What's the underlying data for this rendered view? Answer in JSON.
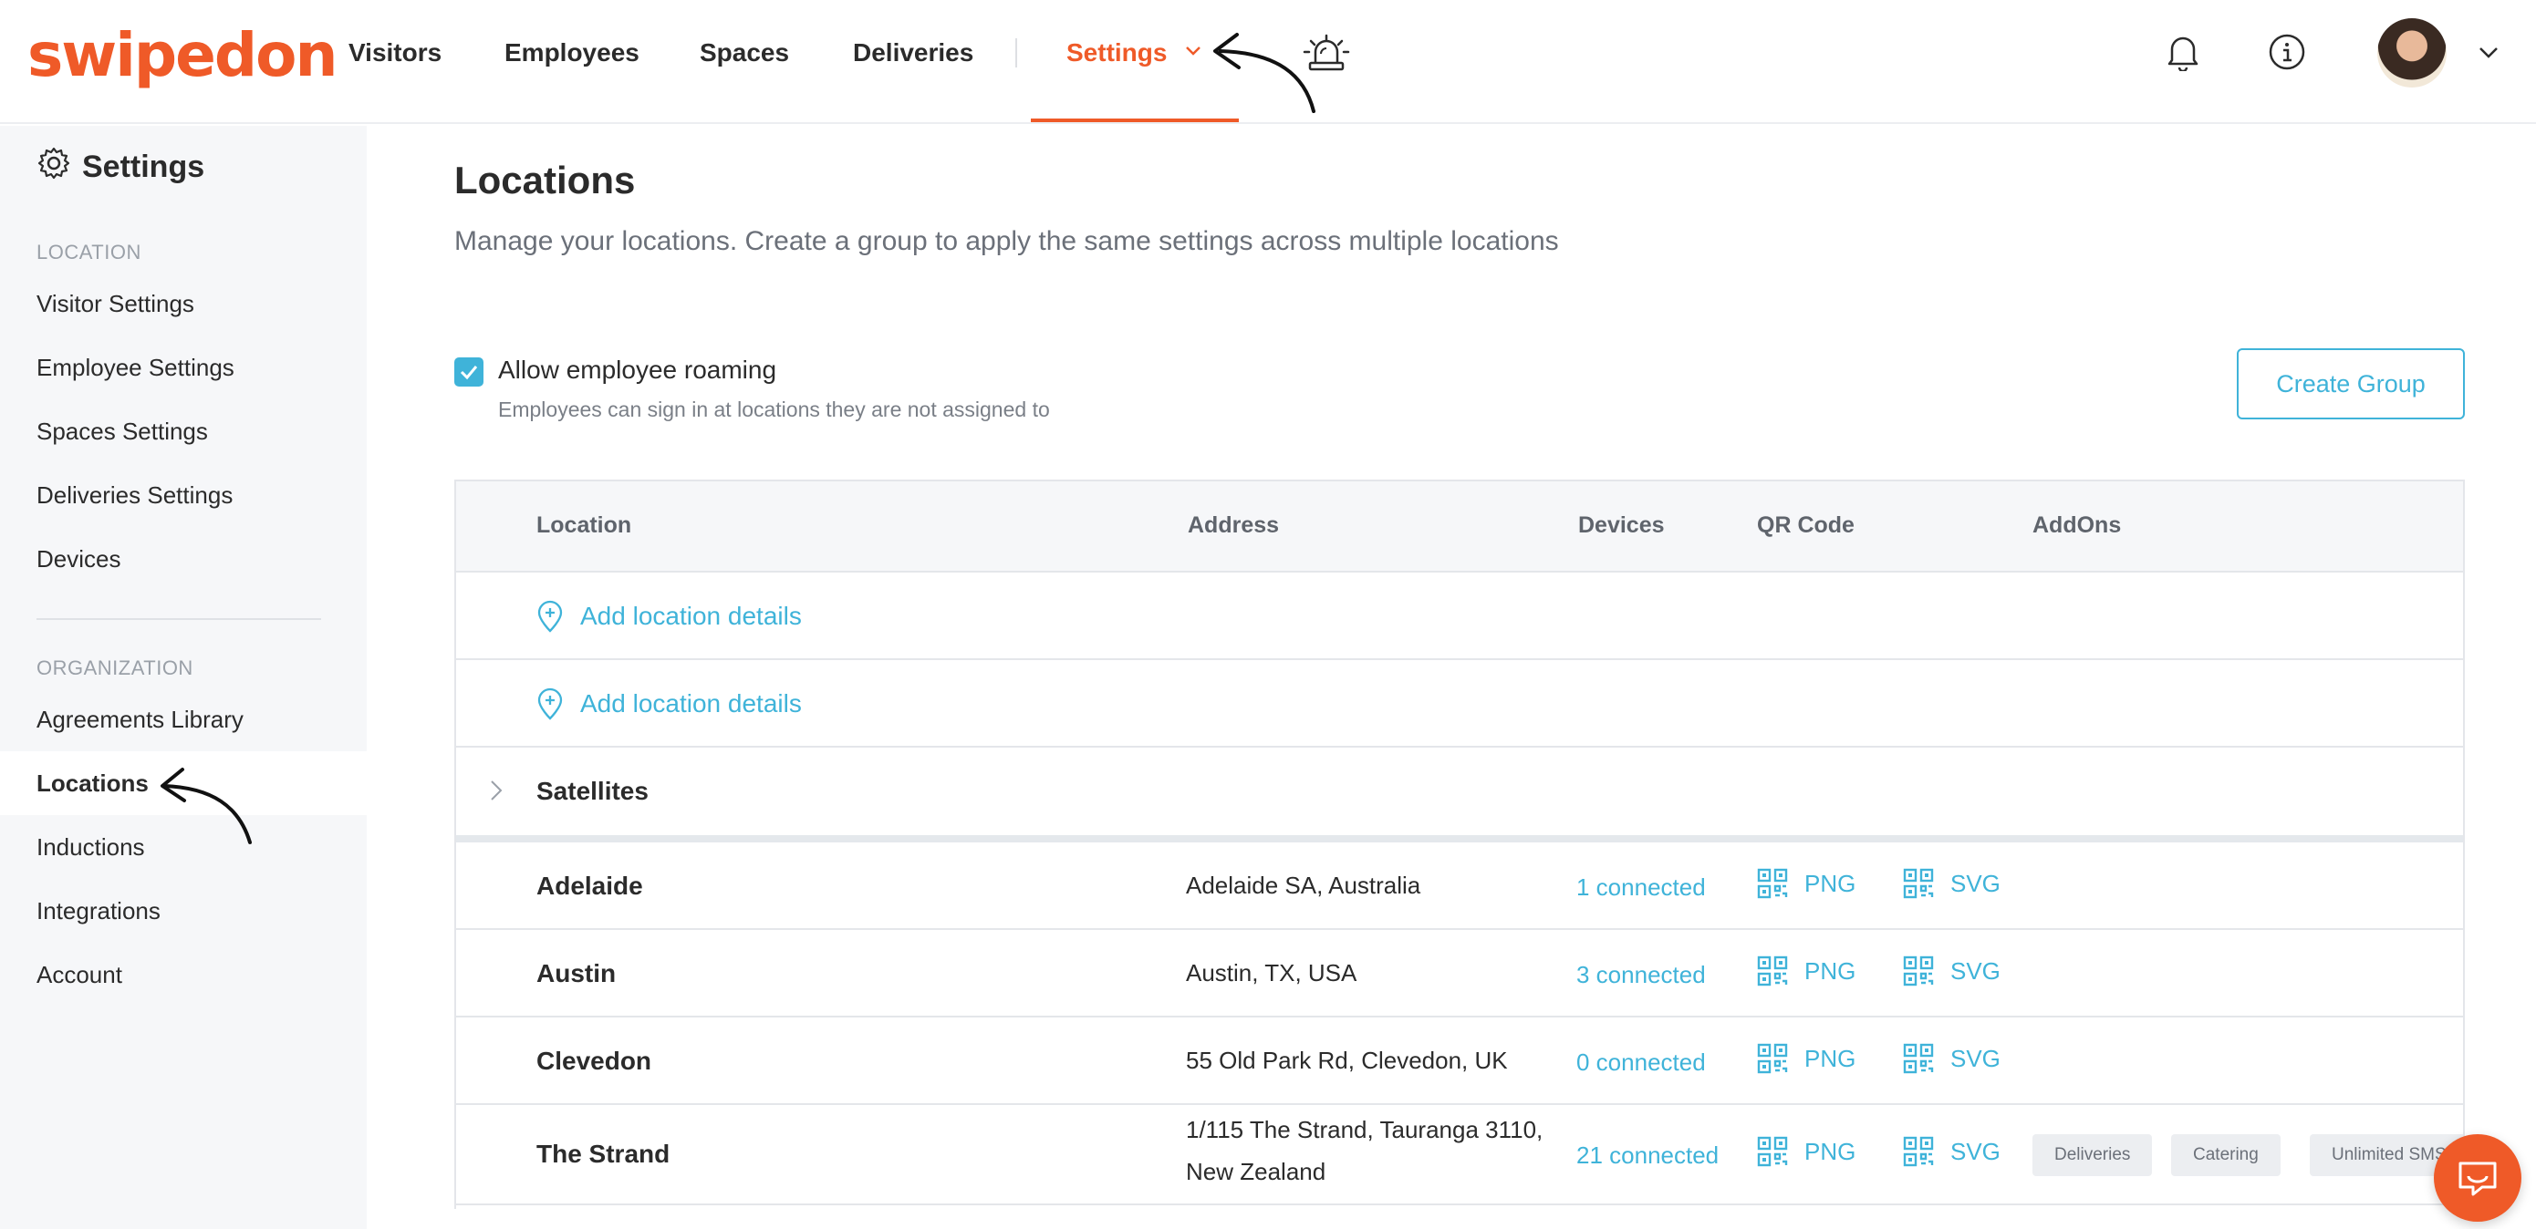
{
  "brand": {
    "logo_text": "swipedon",
    "accent": "#ef5a28",
    "link_color": "#3fb3d9"
  },
  "nav": {
    "items": [
      {
        "label": "Visitors"
      },
      {
        "label": "Employees"
      },
      {
        "label": "Spaces"
      },
      {
        "label": "Deliveries"
      },
      {
        "label": "Settings",
        "active": true
      }
    ],
    "icons": [
      "emergency-alarm-icon",
      "bell-icon",
      "info-icon",
      "avatar",
      "chevron-down-icon"
    ]
  },
  "sidebar": {
    "title": "Settings",
    "location_label": "LOCATION",
    "location_items": [
      {
        "label": "Visitor Settings"
      },
      {
        "label": "Employee Settings"
      },
      {
        "label": "Spaces Settings"
      },
      {
        "label": "Deliveries Settings"
      },
      {
        "label": "Devices"
      }
    ],
    "organization_label": "ORGANIZATION",
    "organization_items": [
      {
        "label": "Agreements Library"
      },
      {
        "label": "Locations",
        "active": true
      },
      {
        "label": "Inductions"
      },
      {
        "label": "Integrations"
      },
      {
        "label": "Account"
      }
    ]
  },
  "main": {
    "title": "Locations",
    "subtitle": "Manage your locations. Create a group to apply the same settings across multiple locations",
    "roaming": {
      "checked": true,
      "label": "Allow employee roaming",
      "help": "Employees can sign in at locations they are not assigned to"
    },
    "create_group_label": "Create Group",
    "table": {
      "headers": [
        "Location",
        "Address",
        "Devices",
        "QR Code",
        "AddOns"
      ],
      "add_location_label": "Add location details",
      "group_name": "Satellites",
      "png_label": "PNG",
      "svg_label": "SVG",
      "rows": [
        {
          "name": "Adelaide",
          "address": "Adelaide SA, Australia",
          "devices": "1 connected",
          "addons": []
        },
        {
          "name": "Austin",
          "address": "Austin, TX, USA",
          "devices": "3 connected",
          "addons": []
        },
        {
          "name": "Clevedon",
          "address": "55 Old Park Rd, Clevedon, UK",
          "devices": "0 connected",
          "addons": []
        },
        {
          "name": "The Strand",
          "address_line1": "1/115 The Strand, Tauranga 3110,",
          "address_line2": "New Zealand",
          "devices": "21 connected",
          "addons": [
            "Deliveries",
            "Catering",
            "Unlimited SMS"
          ]
        }
      ]
    }
  }
}
